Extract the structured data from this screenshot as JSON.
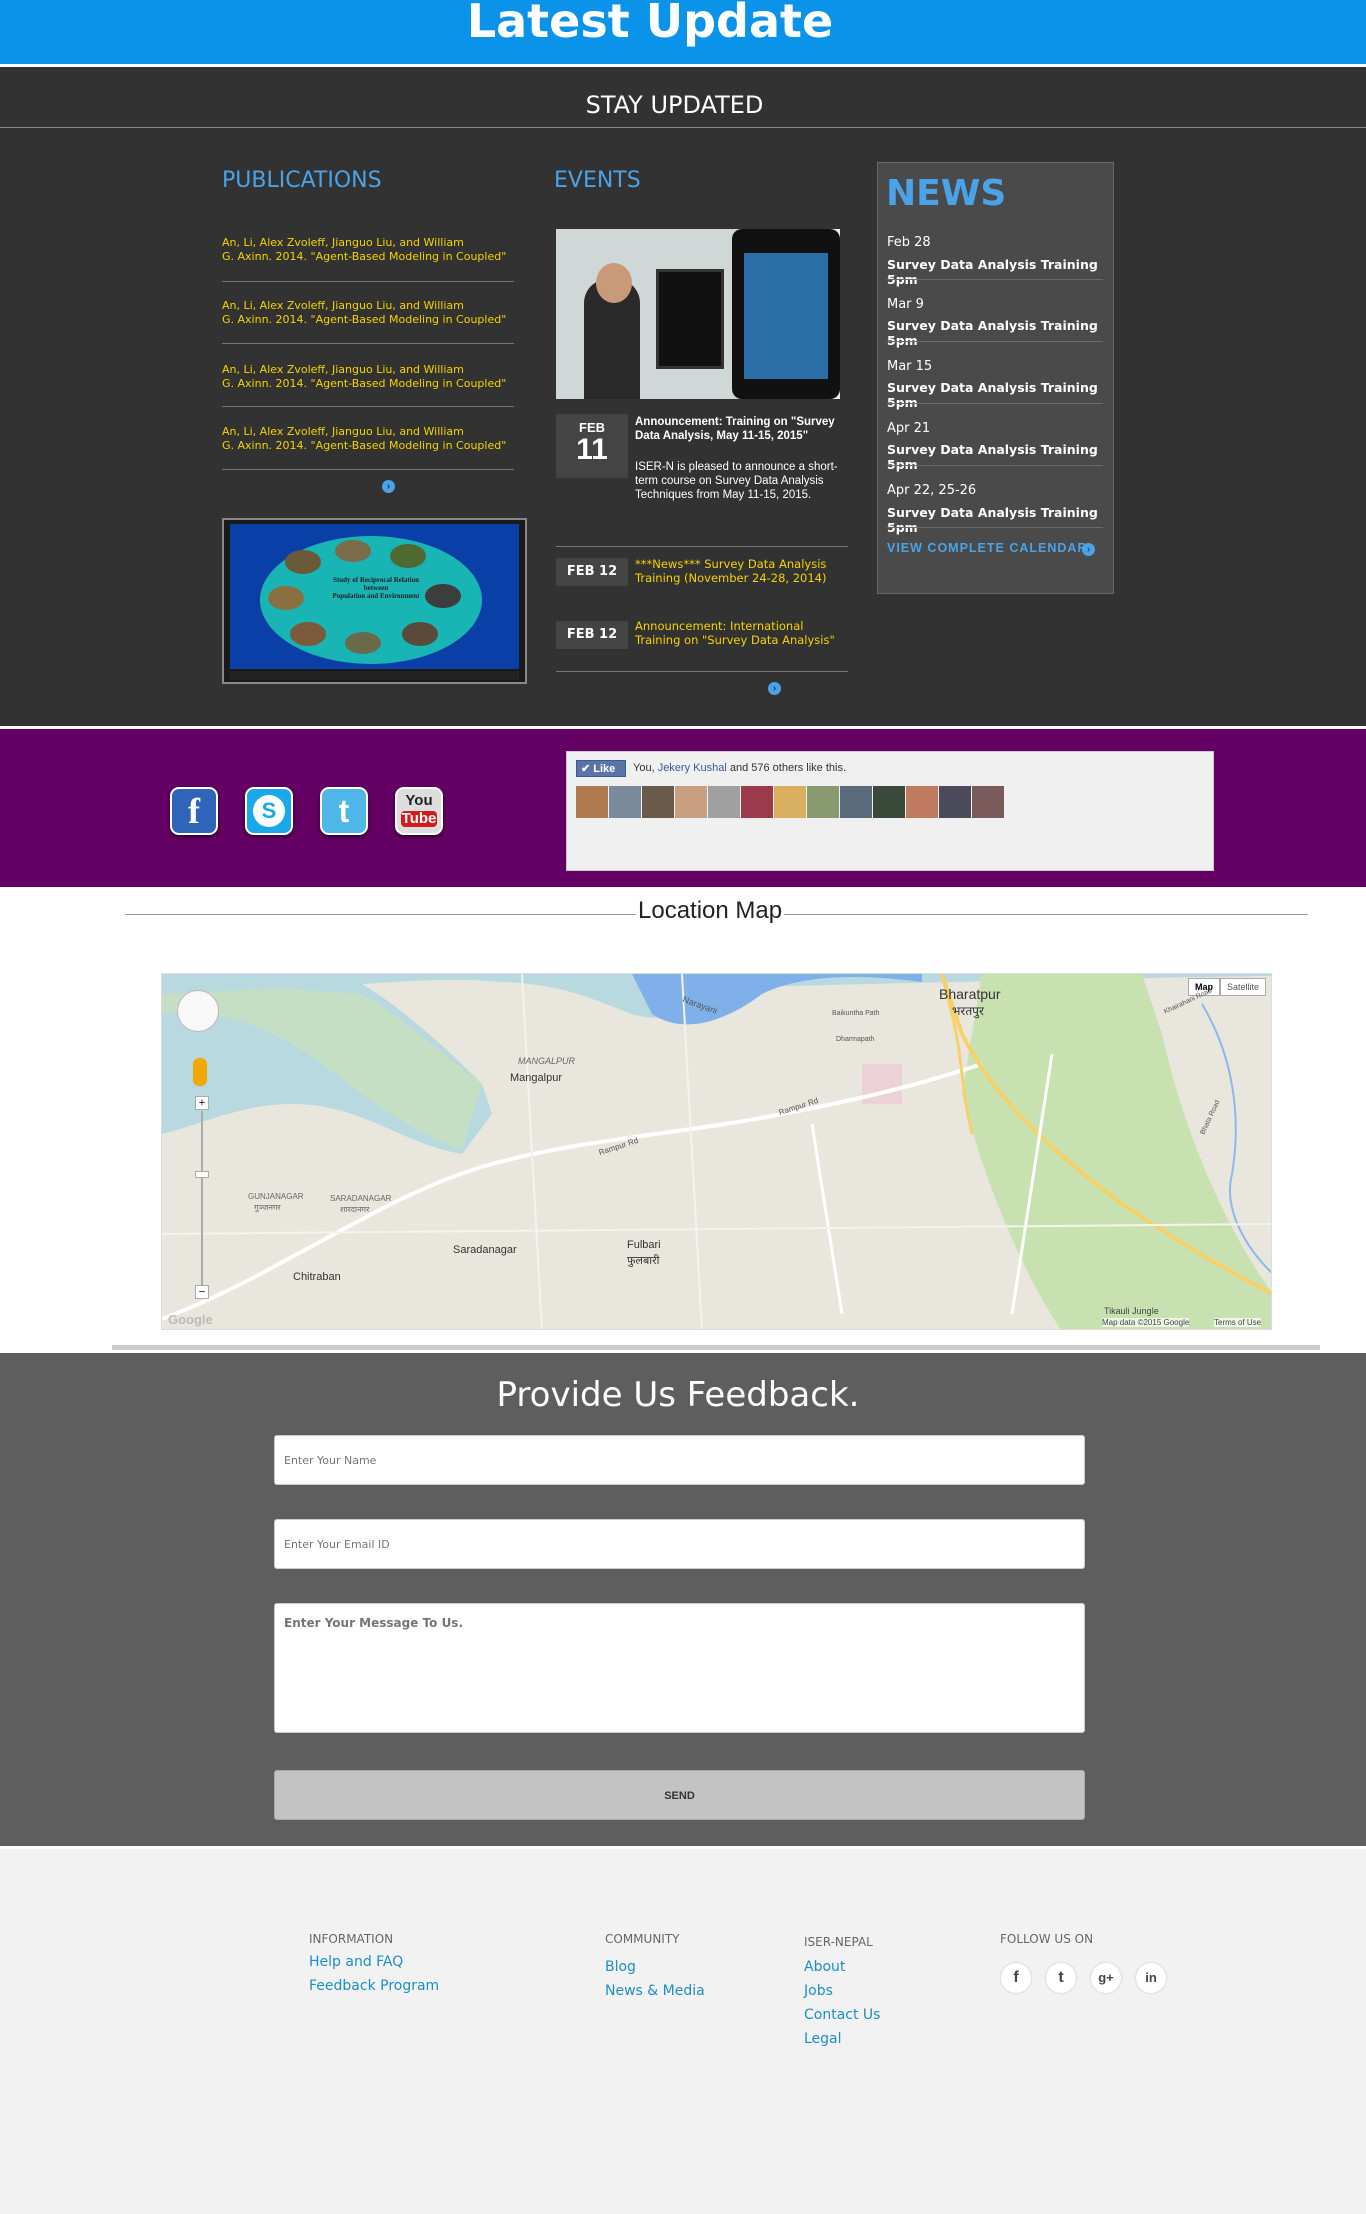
{
  "banner": {
    "title": "Latest Update"
  },
  "stay": {
    "title": "STAY  UPDATED"
  },
  "publications": {
    "heading": "PUBLICATIONS",
    "items": [
      {
        "line1": "An, Li, Alex Zvoleff, Jianguo Liu, and William",
        "line2": "G. Axinn. 2014. \"Agent-Based Modeling in Coupled\""
      },
      {
        "line1": "An, Li, Alex Zvoleff, Jianguo Liu, and William",
        "line2": "G. Axinn. 2014. \"Agent-Based Modeling in Coupled\""
      },
      {
        "line1": "An, Li, Alex Zvoleff, Jianguo Liu, and William",
        "line2": "G. Axinn. 2014. \"Agent-Based Modeling in Coupled\""
      },
      {
        "line1": "An, Li, Alex Zvoleff, Jianguo Liu, and William",
        "line2": "G. Axinn. 2014. \"Agent-Based Modeling in Coupled\""
      }
    ],
    "video_caption_1": "Study of Reciprocal Relation",
    "video_caption_2": "between",
    "video_caption_3": "Population and Environment"
  },
  "events": {
    "heading": "EVENTS",
    "featured": {
      "month": "FEB",
      "day": "11",
      "title": "Announcement: Training on \"Survey Data Analysis, May 11-15, 2015\"",
      "body": "ISER-N is pleased to announce a short-term course on Survey Data Analysis Techniques from May 11-15, 2015."
    },
    "items": [
      {
        "date": "FEB 12",
        "text": "***News*** Survey Data Analysis Training (November 24-28, 2014)"
      },
      {
        "date": "FEB 12",
        "text": "Announcement: International Training on \"Survey Data Analysis\""
      }
    ]
  },
  "news": {
    "heading": "NEWS",
    "items": [
      {
        "date": "Feb 28",
        "title": "Survey Data Analysis Training 5pm"
      },
      {
        "date": "Mar 9",
        "title": "Survey Data Analysis Training 5pm"
      },
      {
        "date": "Mar 15",
        "title": "Survey Data Analysis Training 5pm"
      },
      {
        "date": "Apr 21",
        "title": "Survey Data Analysis Training 5pm"
      },
      {
        "date": "Apr 22, 25-26",
        "title": "Survey Data Analysis Training 5pm"
      }
    ],
    "calendar_link": "VIEW COMPLETE CALENDAR"
  },
  "social": {
    "facebook": "f",
    "skype": "S",
    "twitter": "t",
    "youtube_1": "You",
    "youtube_2": "Tube",
    "like_button": "Like",
    "like_you": "You,",
    "like_name": "Jekery Kushal",
    "like_rest": "and 576 others like this."
  },
  "map": {
    "title": "Location Map",
    "btn_map": "Map",
    "btn_satellite": "Satellite",
    "labels": {
      "bharatpur": "Bharatpur",
      "bharatpur_np": "भरतपुर",
      "mangalpur_caps": "MANGALPUR",
      "mangalpur": "Mangalpur",
      "gunjanagar": "GUNJANAGAR",
      "gunjanagar_np": "गुञ्जनगर",
      "saradanagar_caps": "SARADANAGAR",
      "saradanagar_np": "शारदानगर",
      "saradanagar": "Saradanagar",
      "chitraban": "Chitraban",
      "fulbari": "Fulbari",
      "fulbari_np": "फुलबारी",
      "rampur_rd": "Rampur Rd",
      "rampur_rd2": "Rampur Rd",
      "narayani": "Narayani",
      "baikuntha": "Baikuntha Path",
      "dharmapath": "Dharmapath",
      "tikauli": "Tikauli Jungle",
      "khairahani": "Khairahani Road",
      "bhata_road": "Bhata Road",
      "google": "Google",
      "mapdata": "Map data ©2015 Google",
      "terms": "Terms of Use"
    }
  },
  "feedback": {
    "title": "Provide Us Feedback.",
    "name_placeholder": "Enter Your Name",
    "email_placeholder": "Enter Your Email ID",
    "message_placeholder": "Enter Your Message To Us.",
    "send": "SEND"
  },
  "footer": {
    "information": {
      "heading": "INFORMATION",
      "links": [
        "Help and FAQ",
        "Feedback Program"
      ]
    },
    "community": {
      "heading": "COMMUNITY",
      "links": [
        "Blog",
        "News & Media"
      ]
    },
    "iser": {
      "heading": "ISER-NEPAL",
      "links": [
        "About",
        "Jobs",
        "Contact Us",
        "Legal"
      ]
    },
    "follow": {
      "heading": "FOLLOW US ON",
      "icons": [
        "f",
        "t",
        "g+",
        "in"
      ]
    }
  }
}
